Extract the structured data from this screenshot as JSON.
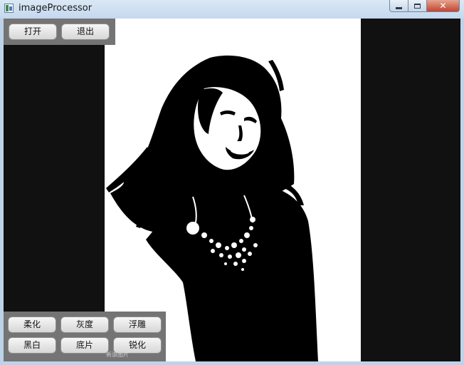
{
  "window": {
    "title": "imageProcessor",
    "icon": "app-window-icon",
    "caption_buttons": [
      "minimize-icon",
      "maximize-icon",
      "close-icon"
    ],
    "close_glyph": "✕"
  },
  "toolbar_top": {
    "open_label": "打开",
    "exit_label": "退出"
  },
  "toolbar_bottom": {
    "soften_label": "柔化",
    "gray_label": "灰度",
    "emboss_label": "浮雕",
    "blackwhite_label": "黑白",
    "negative_label": "底片",
    "sharpen_label": "锐化"
  },
  "image": {
    "subject": "black-and-white processed portrait",
    "background_color": "#111111",
    "canvas_color": "#ffffff"
  },
  "watermark": "新浪图片"
}
